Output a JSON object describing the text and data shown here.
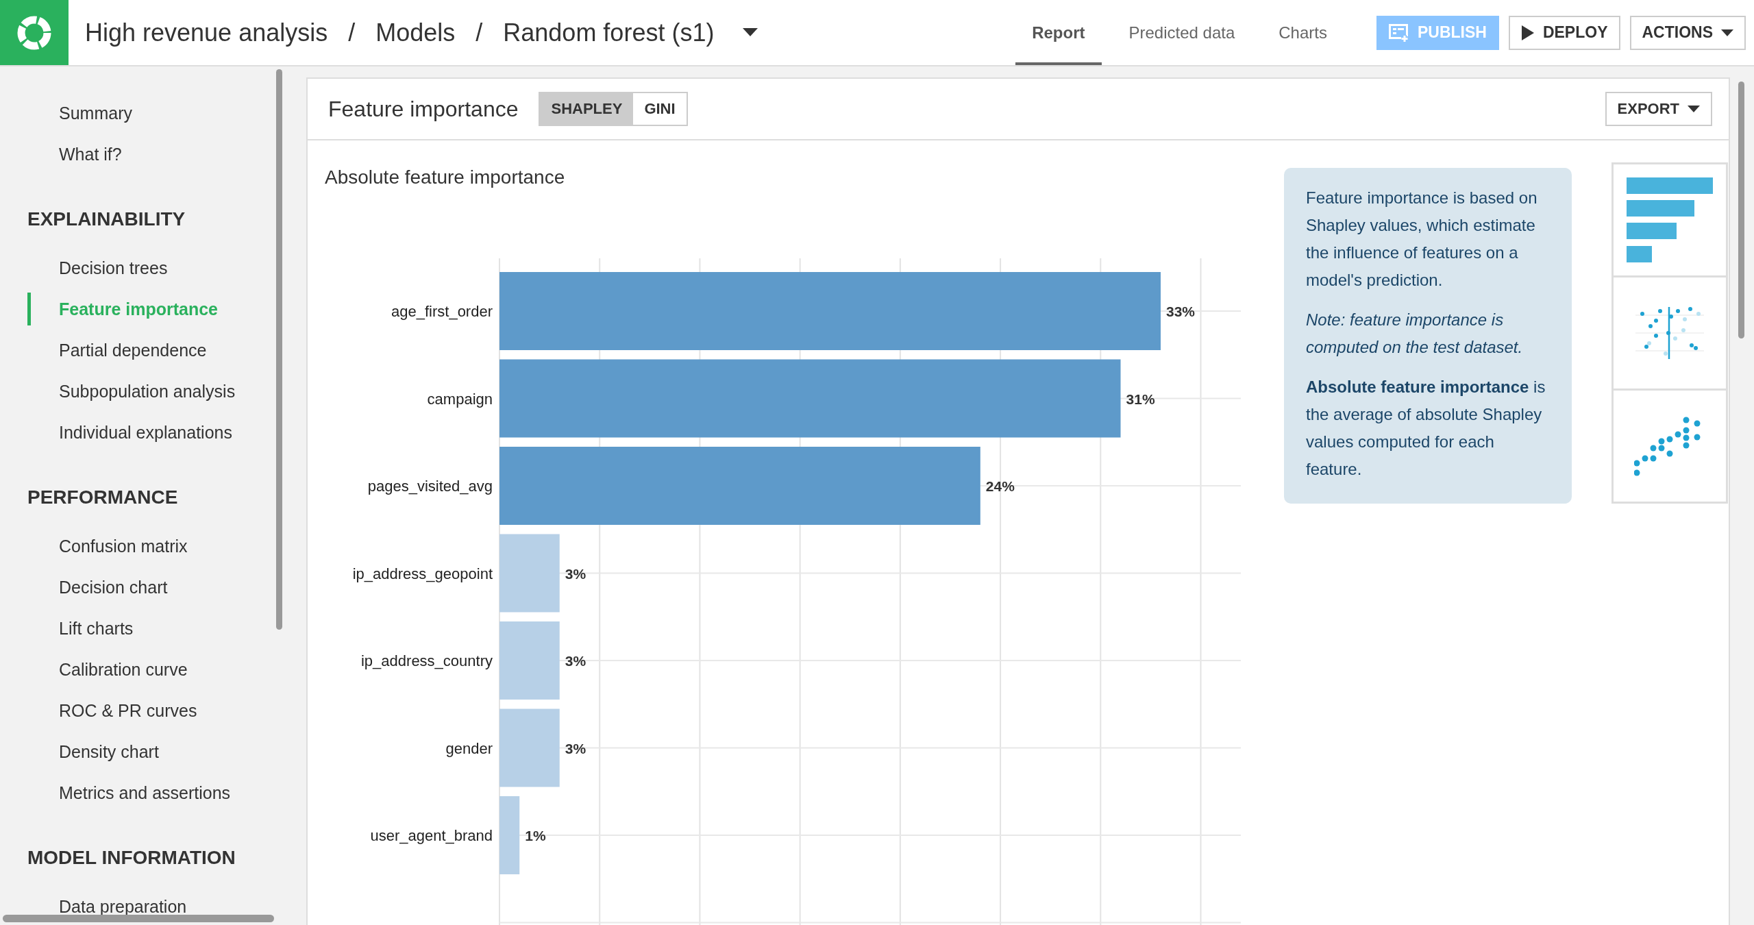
{
  "breadcrumb": [
    {
      "label": "High revenue analysis"
    },
    {
      "label": "/"
    },
    {
      "label": "Models"
    },
    {
      "label": "/"
    },
    {
      "label": "Random forest (s1)"
    }
  ],
  "tabs": [
    {
      "label": "Report",
      "selected": true
    },
    {
      "label": "Predicted data",
      "selected": false
    },
    {
      "label": "Charts",
      "selected": false
    }
  ],
  "buttons": [
    {
      "kind": "publish",
      "label": "PUBLISH"
    },
    {
      "kind": "deploy",
      "label": "DEPLOY"
    },
    {
      "kind": "actions",
      "label": "ACTIONS"
    }
  ],
  "sidebar": {
    "items": [
      {
        "label": "Summary",
        "selected": false
      },
      {
        "label": "What if?",
        "selected": false
      }
    ],
    "sections": [
      {
        "title": "EXPLAINABILITY",
        "items": [
          {
            "label": "Decision trees",
            "selected": false
          },
          {
            "label": "Feature importance",
            "selected": true
          },
          {
            "label": "Partial dependence",
            "selected": false
          },
          {
            "label": "Subpopulation analysis",
            "selected": false
          },
          {
            "label": "Individual explanations",
            "selected": false
          }
        ]
      },
      {
        "title": "PERFORMANCE",
        "items": [
          {
            "label": "Confusion matrix",
            "selected": false
          },
          {
            "label": "Decision chart",
            "selected": false
          },
          {
            "label": "Lift charts",
            "selected": false
          },
          {
            "label": "Calibration curve",
            "selected": false
          },
          {
            "label": "ROC & PR curves",
            "selected": false
          },
          {
            "label": "Density chart",
            "selected": false
          },
          {
            "label": "Metrics and assertions",
            "selected": false
          }
        ]
      },
      {
        "title": "MODEL INFORMATION",
        "items": [
          {
            "label": "Data preparation",
            "selected": false
          }
        ]
      }
    ]
  },
  "panel": {
    "title": "Feature importance",
    "toggle": [
      {
        "label": "SHAPLEY",
        "selected": true
      },
      {
        "label": "GINI",
        "selected": false
      }
    ],
    "export": "EXPORT",
    "chart_data": {
      "type": "bar",
      "orientation": "horizontal",
      "title": "Absolute feature importance",
      "categories": [
        "age_first_order",
        "campaign",
        "pages_visited_avg",
        "ip_address_geopoint",
        "ip_address_country",
        "gender",
        "user_agent_brand"
      ],
      "series": [
        {
          "color": "#5e9aca",
          "values": [
            33,
            31,
            24,
            null,
            null,
            null,
            null
          ],
          "value_labels": [
            "33%",
            "31%",
            "24%",
            null,
            null,
            null,
            null
          ]
        },
        {
          "color": "#b7d0e7",
          "values": [
            null,
            null,
            null,
            3,
            3,
            3,
            1
          ],
          "value_labels": [
            null,
            null,
            null,
            "3%",
            "3%",
            "3%",
            "1%"
          ]
        }
      ],
      "xlim": [
        0,
        37
      ]
    },
    "info": [
      "Feature importance is based on Shapley values, which estimate the influence of features on a model's prediction.",
      "Note: feature importance is computed on the test dataset.",
      "**Absolute feature importance** is the average of absolute Shapley values computed for each feature."
    ]
  }
}
